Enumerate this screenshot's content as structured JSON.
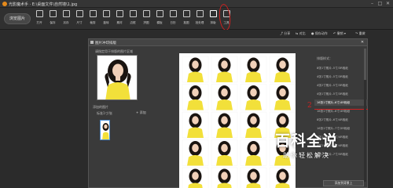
{
  "app": {
    "title": "光影魔术手 · E:\\桌面文件\\自然墙\\1.jpg"
  },
  "window": {
    "min": "–",
    "max": "□",
    "close": "✕"
  },
  "toolbar": {
    "browse_label": "浏览图片",
    "tools": [
      {
        "label": "打开",
        "icon": "open-icon"
      },
      {
        "label": "保存",
        "icon": "save-icon"
      },
      {
        "label": "另存",
        "icon": "save-as-icon"
      },
      {
        "label": "尺寸",
        "icon": "resize-icon"
      },
      {
        "label": "裁剪",
        "icon": "crop-icon"
      },
      {
        "label": "旋转",
        "icon": "rotate-icon"
      },
      {
        "label": "素材",
        "icon": "material-icon"
      },
      {
        "label": "边框",
        "icon": "frame-icon"
      },
      {
        "label": "拼图",
        "icon": "collage-icon"
      },
      {
        "label": "模板",
        "icon": "template-icon"
      },
      {
        "label": "日历",
        "icon": "calendar-icon"
      },
      {
        "label": "抠图",
        "icon": "cutout-icon"
      },
      {
        "label": "批处理",
        "icon": "batch-icon"
      },
      {
        "label": "排版",
        "icon": "layout-icon"
      },
      {
        "label": "工具",
        "icon": "tools-icon"
      }
    ]
  },
  "subbar": {
    "share": "分享",
    "compare": "对比",
    "save_action": "保存动作",
    "undo": "撤销",
    "redo": "重做"
  },
  "panel": {
    "title": "图片冲印排版",
    "close": "✕",
    "source_label": "请指定用于排版的图片区域",
    "add_label": "添加的图片",
    "spec_label": "标准1寸/张",
    "add_button": "+ 添加",
    "layout_style_label": "排版样式：",
    "options": [
      "8张1寸照片–5寸/3R相纸",
      "4张1寸照片–5寸/3R相纸",
      "4张2寸照片–5寸/3R相纸",
      "4张1寸照片–5寸/3R相纸",
      "16张1寸照片–6寸/4R相纸",
      "16张1寸照片–6寸/4R相纸",
      "8张2寸照片–6寸/4R相纸",
      "16张1寸照片–7寸/5R相纸",
      "4张1寸照片–6寸/4R相纸",
      "8张2寸照片–6寸/4R相纸",
      "4张2寸照片–7寸/5R相纸"
    ],
    "selected_index": 4,
    "annotation_number": "2",
    "fill_button": "添加到背景上"
  },
  "watermark": {
    "main": "百科全说",
    "sub": "助你轻松解决"
  },
  "colors": {
    "accent_red": "#d12020",
    "photo_bg": "#ffffff",
    "dress_yellow": "#f2e03a",
    "hair_dark": "#1a1410"
  }
}
